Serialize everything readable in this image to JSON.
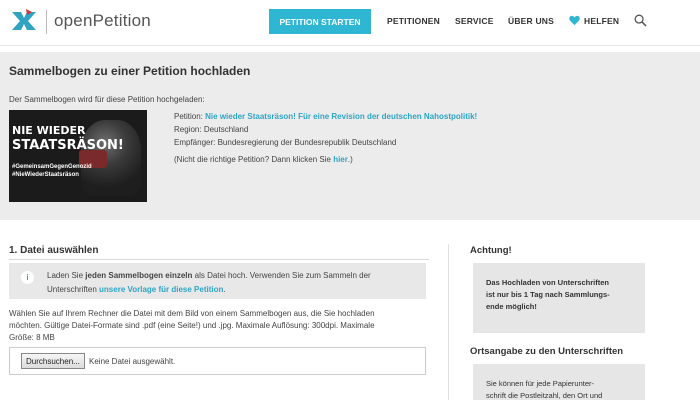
{
  "nav": {
    "logo_text": "openPetition",
    "start_button": "PETITION STARTEN",
    "links": [
      "PETITIONEN",
      "SERVICE",
      "ÜBER UNS",
      "HELFEN"
    ],
    "icons": [
      "logo-icon",
      "heart-icon",
      "search-icon"
    ],
    "accent_color": "#2fb6d3"
  },
  "upload": {
    "title": "Sammelbogen zu einer Petition hochladen",
    "subtitle": "Der Sammelbogen wird für diese Petition hochgeladen:",
    "image_text": {
      "line1": "NIE WIEDER",
      "line2": "STAATSRÄSON!",
      "tag1": "#GemeinsamGegenGenozid",
      "tag2": "#NieWiederStaatsräson"
    },
    "petition_label": "Petition:",
    "petition_name": "Nie wieder Staatsräson! Für eine Revision der deutschen Nahostpolitik!",
    "region_label": "Region:",
    "region": "Deutschland",
    "recipient_label": "Empfänger:",
    "recipient": "Bundesregierung der Bundesrepublik Deutschland",
    "wrong_petition_pre": "(Nicht die richtige Petition? Dann klicken Sie ",
    "wrong_petition_link": "hier",
    "wrong_petition_post": ".)"
  },
  "step1": {
    "title": "1. Datei auswählen",
    "notice_pre": "Laden Sie ",
    "notice_bold": "jeden Sammelbogen einzeln",
    "notice_mid": " als Datei hoch. Verwenden Sie zum Sammeln der",
    "notice_line2_pre": "Unterschriften ",
    "notice_link": "unsere Vorlage für diese Petition",
    "notice_line2_post": ".",
    "help_line1": "Wählen Sie auf Ihrem Rechner die Datei mit dem Bild von einem Sammelbogen aus, die Sie hochladen",
    "help_line2": "möchten. Gültige Datei-Formate sind .pdf (eine Seite!) und .jpg. Maximale Auflösung: 300dpi. Maximale",
    "help_line3": "Größe: 8 MB",
    "browse_button": "Durchsuchen...",
    "file_status": "Keine Datei ausgewählt."
  },
  "sidebar": {
    "attention_title": "Achtung!",
    "attention_line1": "Das Hochladen von Unterschriften",
    "attention_line2": "ist nur bis 1 Tag nach Sammlungs-",
    "attention_line3": "ende möglich!",
    "location_title": "Ortsangabe zu den Unterschriften",
    "location_line1": "Sie können für jede Papierunter-",
    "location_line2": "schrift die Postleitzahl, den Ort und"
  }
}
